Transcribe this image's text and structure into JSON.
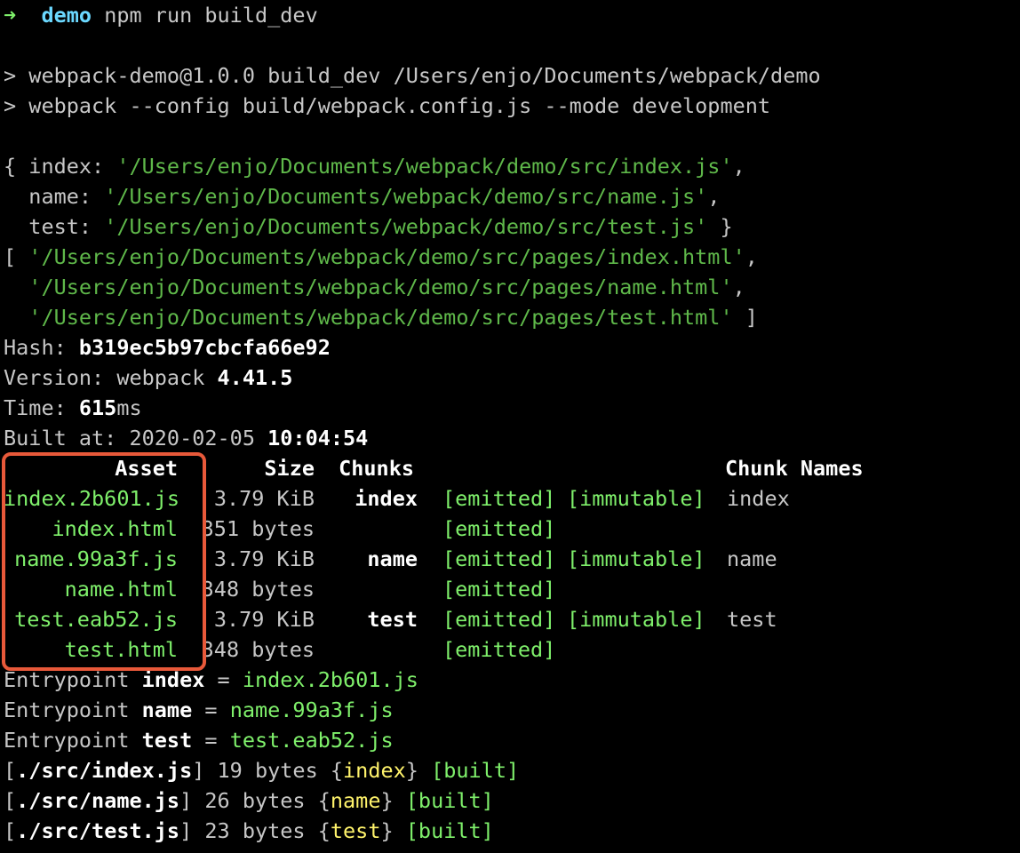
{
  "prompt": {
    "arrow": "➜",
    "dir": "demo",
    "command": "npm run build_dev"
  },
  "script_lines": [
    "> webpack-demo@1.0.0 build_dev /Users/enjo/Documents/webpack/demo",
    "> webpack --config build/webpack.config.js --mode development"
  ],
  "entries": [
    {
      "pre": "{ ",
      "key": "index: ",
      "value": "'/Users/enjo/Documents/webpack/demo/src/index.js'",
      "post": ","
    },
    {
      "pre": "  ",
      "key": "name: ",
      "value": "'/Users/enjo/Documents/webpack/demo/src/name.js'",
      "post": ","
    },
    {
      "pre": "  ",
      "key": "test: ",
      "value": "'/Users/enjo/Documents/webpack/demo/src/test.js'",
      "post": " }"
    }
  ],
  "pages": [
    {
      "pre": "[ ",
      "value": "'/Users/enjo/Documents/webpack/demo/src/pages/index.html'",
      "post": ","
    },
    {
      "pre": "  ",
      "value": "'/Users/enjo/Documents/webpack/demo/src/pages/name.html'",
      "post": ","
    },
    {
      "pre": "  ",
      "value": "'/Users/enjo/Documents/webpack/demo/src/pages/test.html'",
      "post": " ]"
    }
  ],
  "stats": {
    "hash_label": "Hash: ",
    "hash": "b319ec5b97cbcfa66e92",
    "version_label": "Version: webpack ",
    "version": "4.41.5",
    "time_label": "Time: ",
    "time": "615",
    "time_unit": "ms",
    "built_label": "Built at: 2020-02-05 ",
    "built_time": "10:04:54"
  },
  "assets_table": {
    "headers": {
      "asset": "Asset",
      "size": "Size",
      "chunks": "Chunks",
      "chunk_names": "Chunk Names"
    },
    "rows": [
      {
        "asset": "index.2b601.js",
        "size": "3.79 KiB",
        "chunks": "index",
        "emitted": "[emitted]",
        "immutable": "[immutable]",
        "names": "index"
      },
      {
        "asset": "index.html",
        "size": "351 bytes",
        "chunks": "",
        "emitted": "[emitted]",
        "immutable": "",
        "names": ""
      },
      {
        "asset": "name.99a3f.js",
        "size": "3.79 KiB",
        "chunks": "name",
        "emitted": "[emitted]",
        "immutable": "[immutable]",
        "names": "name"
      },
      {
        "asset": "name.html",
        "size": "348 bytes",
        "chunks": "",
        "emitted": "[emitted]",
        "immutable": "",
        "names": ""
      },
      {
        "asset": "test.eab52.js",
        "size": "3.79 KiB",
        "chunks": "test",
        "emitted": "[emitted]",
        "immutable": "[immutable]",
        "names": "test"
      },
      {
        "asset": "test.html",
        "size": "348 bytes",
        "chunks": "",
        "emitted": "[emitted]",
        "immutable": "",
        "names": ""
      }
    ]
  },
  "entrypoints": [
    {
      "label": "Entrypoint ",
      "name": "index",
      "eq": " = ",
      "file": "index.2b601.js"
    },
    {
      "label": "Entrypoint ",
      "name": "name",
      "eq": " = ",
      "file": "name.99a3f.js"
    },
    {
      "label": "Entrypoint ",
      "name": "test",
      "eq": " = ",
      "file": "test.eab52.js"
    }
  ],
  "modules": [
    {
      "open": "[",
      "path": "./src/index.js",
      "close": "]",
      "bytes": " 19 bytes {",
      "chunk": "index",
      "end": "} ",
      "built": "[built]"
    },
    {
      "open": "[",
      "path": "./src/name.js",
      "close": "]",
      "bytes": " 26 bytes {",
      "chunk": "name",
      "end": "} ",
      "built": "[built]"
    },
    {
      "open": "[",
      "path": "./src/test.js",
      "close": "]",
      "bytes": " 23 bytes {",
      "chunk": "test",
      "end": "} ",
      "built": "[built]"
    }
  ],
  "colors": {
    "background": "#000000",
    "text": "#c7c7c7",
    "string_green": "#5fb84a",
    "bright_green": "#7ff06b",
    "yellow": "#fff36b",
    "cyan": "#6bd8ff",
    "highlight": "#e8593a"
  }
}
